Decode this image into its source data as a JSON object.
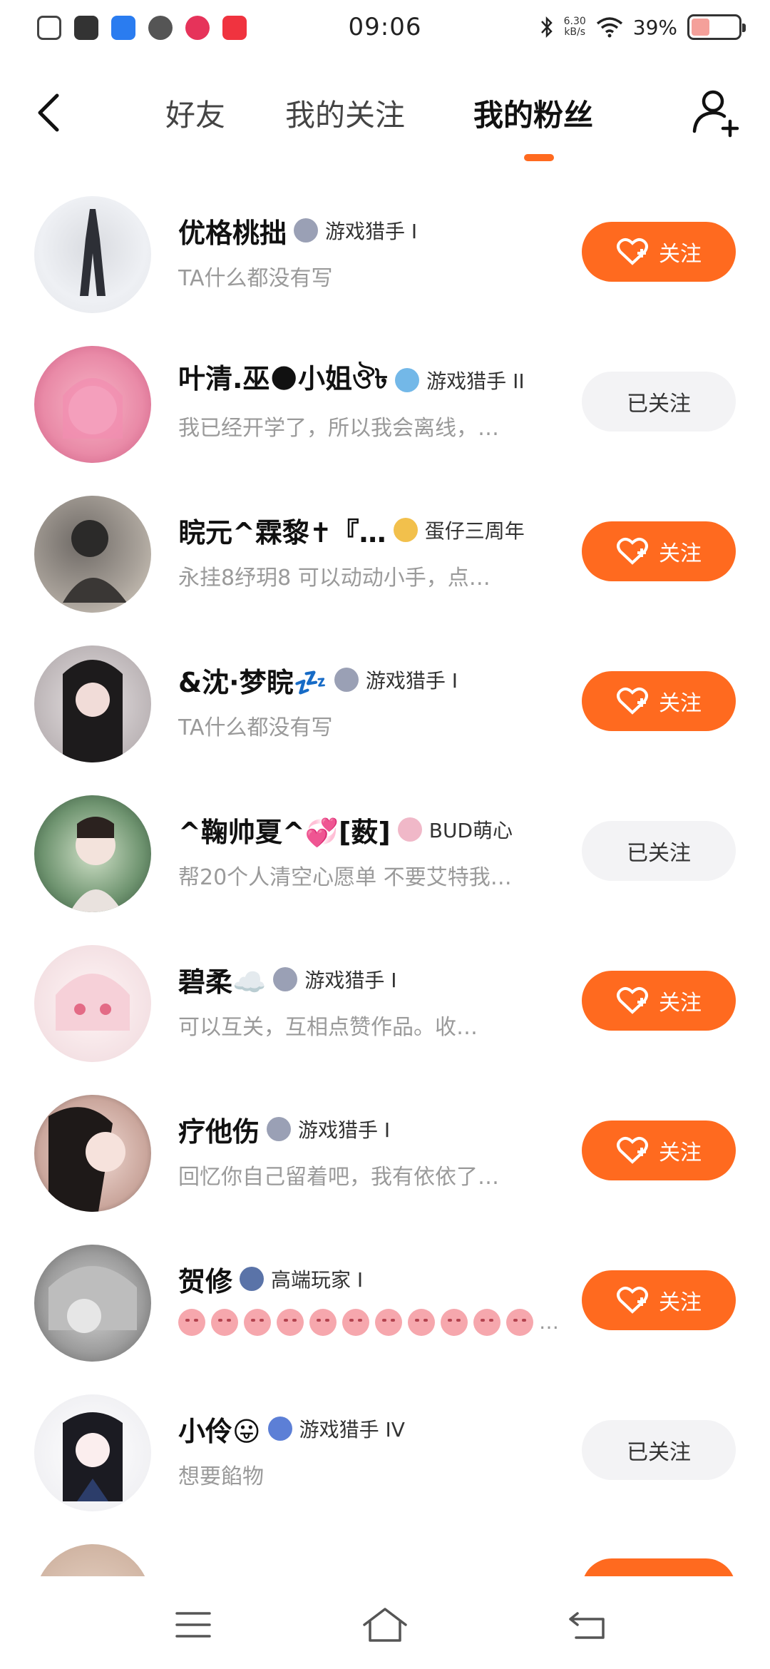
{
  "status_bar": {
    "time": "09:06",
    "net_speed_value": "6.30",
    "net_speed_unit": "kB/s",
    "battery": "39%",
    "battery_level": 0.39
  },
  "header": {
    "tabs": [
      {
        "label": "好友"
      },
      {
        "label": "我的关注"
      },
      {
        "label": "我的粉丝",
        "active": true
      }
    ]
  },
  "fans": [
    {
      "name": "优格桃拙",
      "badge": "游戏猎手 I",
      "bio": "TA什么都没有写",
      "button": "关注",
      "state": "follow"
    },
    {
      "name": "叶清.巫🌑小姐ঔ৳",
      "badge": "游戏猎手 II",
      "bio": "我已经开学了，所以我会离线，…",
      "button": "已关注",
      "state": "followed"
    },
    {
      "name": "睆元^霖黎✝『…",
      "badge": "蛋仔三周年",
      "bio": "永挂8纾玥8 可以动动小手，点…",
      "button": "关注",
      "state": "follow"
    },
    {
      "name": "&沈·梦睆💤",
      "badge": "游戏猎手 I",
      "bio": "TA什么都没有写",
      "button": "关注",
      "state": "follow"
    },
    {
      "name": "^鞠帅夏^💞[薮]",
      "badge": "BUD萌心",
      "bio": "帮20个人清空心愿单 不要艾特我…",
      "button": "已关注",
      "state": "followed"
    },
    {
      "name": "碧柔☁️",
      "badge": "游戏猎手 I",
      "bio": "可以互关，互相点赞作品。收…",
      "button": "关注",
      "state": "follow"
    },
    {
      "name": "疗他伤",
      "badge": "游戏猎手 I",
      "bio": "回忆你自己留着吧，我有依依了…",
      "button": "关注",
      "state": "follow"
    },
    {
      "name": "贺修",
      "badge": "高端玩家 I",
      "bio": "…",
      "button": "关注",
      "state": "follow",
      "bio_emoji": true
    },
    {
      "name": "小伶😛",
      "badge": "游戏猎手 IV",
      "bio": "想要餡物",
      "button": "已关注",
      "state": "followed"
    }
  ],
  "colors": {
    "accent": "#ff6a1f",
    "followed_bg": "#f3f3f5",
    "bio_text": "#9a9a9a"
  },
  "icons": {
    "back": "chevron-left-icon",
    "add_friend": "add-user-icon",
    "follow": "heart-plus-icon",
    "nav_menu": "menu-icon",
    "nav_home": "home-icon",
    "nav_back": "back-icon"
  }
}
